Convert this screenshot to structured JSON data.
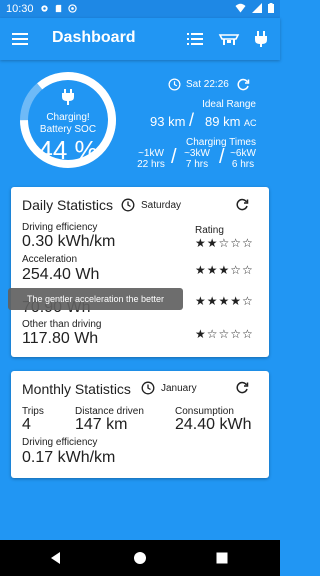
{
  "status_bar": {
    "time": "10:30"
  },
  "app_bar": {
    "title": "Dashboard",
    "actions": [
      "list-icon",
      "vehicle-icon",
      "plug-icon"
    ]
  },
  "hero": {
    "charging_line1": "Charging!",
    "charging_line2": "Battery SOC",
    "soc_percent": "44 %",
    "soc_value": 0.44,
    "datetime": "Sat 22:26",
    "ideal_range_label": "Ideal Range",
    "ideal_range_km": "93 km",
    "ideal_range_ac": "89 km",
    "ideal_range_ac_suffix": "AC",
    "charging_times_label": "Charging Times",
    "charging_times": [
      {
        "power": "~1kW",
        "time": "22 hrs"
      },
      {
        "power": "~3kW",
        "time": "7 hrs"
      },
      {
        "power": "~6kW",
        "time": "6 hrs"
      }
    ]
  },
  "daily": {
    "title": "Daily Statistics",
    "day": "Saturday",
    "rating_label": "Rating",
    "rows": [
      {
        "label": "Driving efficiency",
        "value": "0.30 kWh/km",
        "stars": "★★☆☆☆",
        "rating": 2
      },
      {
        "label": "Acceleration",
        "value": "254.40 Wh",
        "stars": "★★★☆☆",
        "rating": 3
      },
      {
        "label": "",
        "value": "70.90 Wh",
        "stars": "★★★★☆",
        "rating": 4
      },
      {
        "label": "Other than driving",
        "value": "117.80 Wh",
        "stars": "★☆☆☆☆",
        "rating": 1
      }
    ],
    "tooltip": "The gentler acceleration the better"
  },
  "monthly": {
    "title": "Monthly Statistics",
    "month": "January",
    "trips_label": "Trips",
    "trips_value": "4",
    "distance_label": "Distance driven",
    "distance_value": "147 km",
    "consumption_label": "Consumption",
    "consumption_value": "24.40 kWh",
    "efficiency_label": "Driving efficiency",
    "efficiency_value": "0.17 kWh/km"
  },
  "colors": {
    "primary": "#2196f3",
    "status": "#1e88e5",
    "card": "#ffffff"
  }
}
